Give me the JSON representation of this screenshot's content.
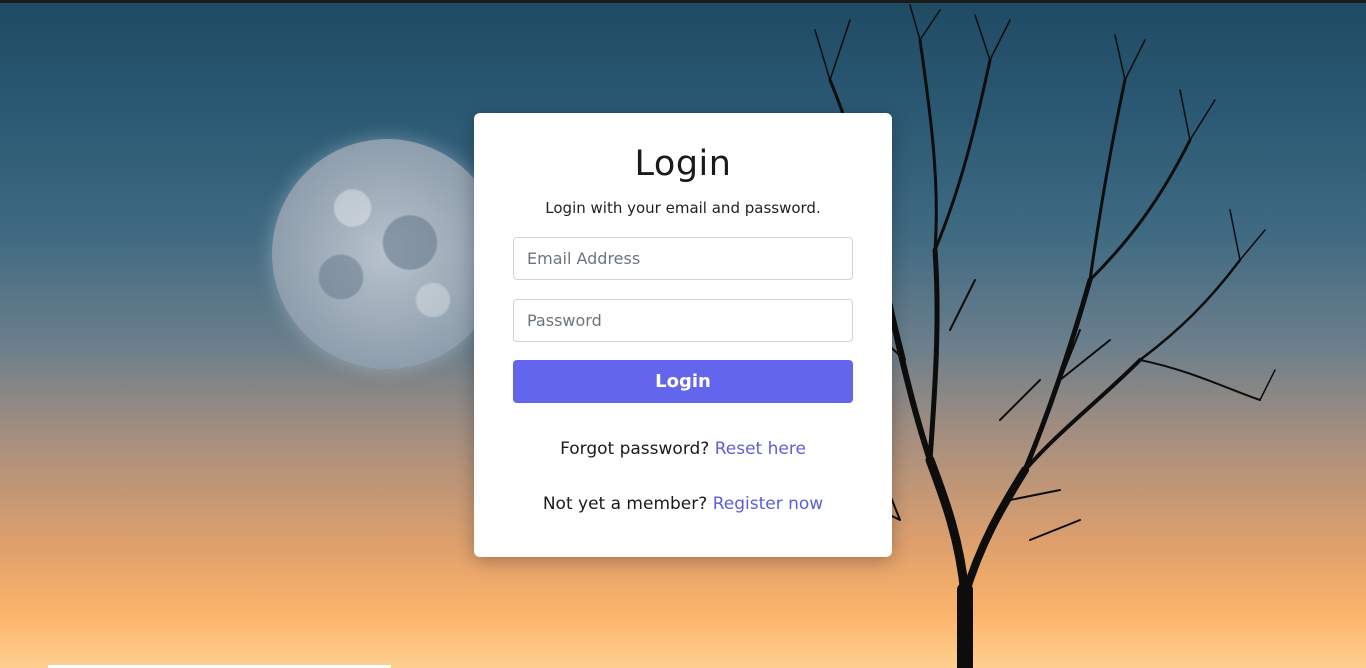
{
  "login": {
    "title": "Login",
    "subtitle": "Login with your email and password.",
    "email_placeholder": "Email Address",
    "email_value": "",
    "password_placeholder": "Password",
    "password_value": "",
    "submit_label": "Login",
    "forgot_text": "Forgot password?",
    "forgot_link": "Reset here",
    "register_text": "Not yet a member?",
    "register_link": "Register now"
  },
  "colors": {
    "accent": "#6366ec",
    "link": "#5a5ee0",
    "card_bg": "#ffffff"
  }
}
